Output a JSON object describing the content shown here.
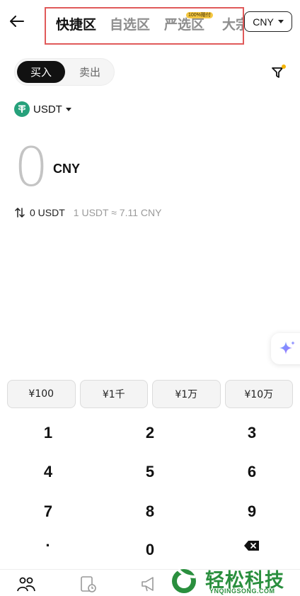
{
  "header": {
    "tabs": [
      {
        "label": "快捷区",
        "active": true
      },
      {
        "label": "自选区",
        "active": false
      },
      {
        "label": "严选区",
        "active": false,
        "badge": "100%赔付"
      },
      {
        "label": "大宗",
        "active": false
      }
    ],
    "currency": "CNY"
  },
  "trade_toggle": {
    "buy": "买入",
    "sell": "卖出"
  },
  "asset": {
    "symbol": "USDT"
  },
  "amount": {
    "value": "0",
    "unit": "CNY"
  },
  "conversion": {
    "amount": "0 USDT",
    "rate": "1 USDT ≈ 7.11 CNY"
  },
  "quick_amounts": [
    "¥100",
    "¥1千",
    "¥1万",
    "¥10万"
  ],
  "keypad": {
    "keys": [
      "1",
      "2",
      "3",
      "4",
      "5",
      "6",
      "7",
      "8",
      "9",
      "·",
      "0"
    ]
  },
  "watermark": {
    "title": "轻松科技",
    "subtitle": "YNQINGSONG.COM"
  },
  "colors": {
    "accent": "#111111",
    "highlight_box": "#e05a5a",
    "usdt": "#26a17b",
    "badge": "#f5c842",
    "watermark": "#2a8f3e"
  }
}
